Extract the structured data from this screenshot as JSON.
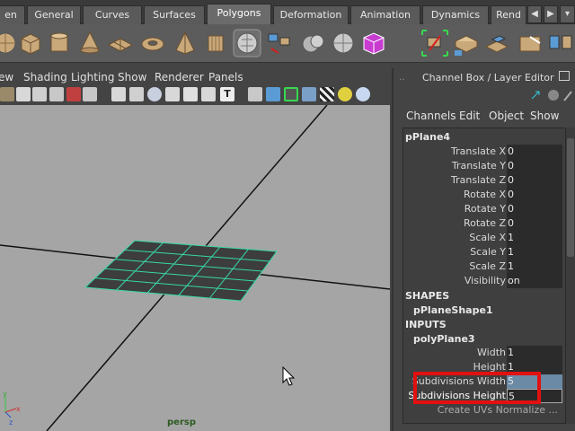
{
  "shelf": {
    "tabs": [
      "en",
      "General",
      "Curves",
      "Surfaces",
      "Polygons",
      "Deformation",
      "Animation",
      "Dynamics",
      "Rend"
    ],
    "active_tab": "Polygons",
    "prev_label": "◀",
    "next_label": "▶",
    "menu_label": "▾"
  },
  "viewport": {
    "menus": [
      "ew",
      "Shading",
      "Lighting",
      "Show",
      "Renderer",
      "Panels"
    ],
    "camera_label": "persp"
  },
  "channel_box": {
    "title": "Channel Box / Layer Editor",
    "menus": [
      "Channels",
      "Edit",
      "Object",
      "Show"
    ],
    "object_name": "pPlane4",
    "transform_attrs": [
      {
        "label": "Translate X",
        "value": "0"
      },
      {
        "label": "Translate Y",
        "value": "0"
      },
      {
        "label": "Translate Z",
        "value": "0"
      },
      {
        "label": "Rotate X",
        "value": "0"
      },
      {
        "label": "Rotate Y",
        "value": "0"
      },
      {
        "label": "Rotate Z",
        "value": "0"
      },
      {
        "label": "Scale X",
        "value": "1"
      },
      {
        "label": "Scale Y",
        "value": "1"
      },
      {
        "label": "Scale Z",
        "value": "1"
      },
      {
        "label": "Visibility",
        "value": "on"
      }
    ],
    "shapes_header": "SHAPES",
    "shape_name": "pPlaneShape1",
    "inputs_header": "INPUTS",
    "input_name": "polyPlane3",
    "input_attrs": [
      {
        "label": "Width",
        "value": "1"
      },
      {
        "label": "Height",
        "value": "1"
      },
      {
        "label": "Subdivisions Width",
        "value": "5"
      },
      {
        "label": "Subdivisions Height",
        "value": "5"
      }
    ],
    "truncated_row": "Create UVs Normalize ..."
  },
  "colors": {
    "accent_cyan": "#38d8a8",
    "highlight_red": "#e21010",
    "viewport_bg": "#a5a5a5"
  }
}
